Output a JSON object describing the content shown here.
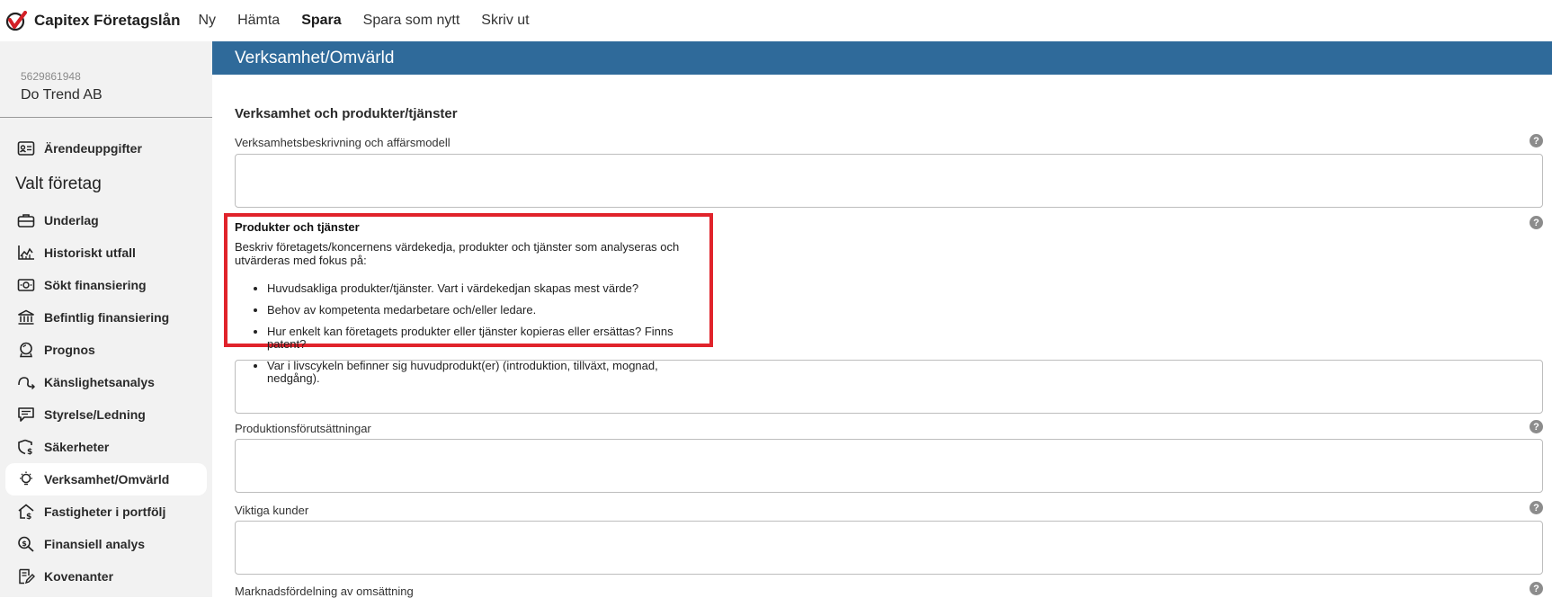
{
  "app": {
    "name": "Capitex Företagslån",
    "brand_color": "#d32027"
  },
  "topmenu": {
    "items": [
      {
        "label": "Ny"
      },
      {
        "label": "Hämta"
      },
      {
        "label": "Spara"
      },
      {
        "label": "Spara som nytt"
      },
      {
        "label": "Skriv ut"
      }
    ]
  },
  "company": {
    "orgnr": "5629861948",
    "name": "Do Trend AB"
  },
  "nav": {
    "case_item": {
      "label": "Ärendeuppgifter",
      "icon": "id-card-icon"
    },
    "section_label": "Valt företag",
    "items": [
      {
        "label": "Underlag",
        "icon": "briefcase-icon"
      },
      {
        "label": "Historiskt utfall",
        "icon": "chart-icon"
      },
      {
        "label": "Sökt finansiering",
        "icon": "money-icon"
      },
      {
        "label": "Befintlig finansiering",
        "icon": "bank-icon"
      },
      {
        "label": "Prognos",
        "icon": "crystal-ball-icon"
      },
      {
        "label": "Känslighetsanalys",
        "icon": "trend-arrow-icon"
      },
      {
        "label": "Styrelse/Ledning",
        "icon": "comment-icon"
      },
      {
        "label": "Säkerheter",
        "icon": "shield-dollar-icon"
      },
      {
        "label": "Verksamhet/Omvärld",
        "icon": "lightbulb-icon",
        "active": true
      },
      {
        "label": "Fastigheter i portfölj",
        "icon": "house-icon"
      },
      {
        "label": "Finansiell analys",
        "icon": "search-dollar-icon"
      },
      {
        "label": "Kovenanter",
        "icon": "document-edit-icon"
      }
    ]
  },
  "main": {
    "section_title": "Verksamhet/Omvärld",
    "subheading": "Verksamhet och produkter/tjänster",
    "fields": {
      "field1_label": "Verksamhetsbeskrivning och affärsmodell",
      "field3_label": "Produktionsförutsättningar",
      "field4_label": "Viktiga kunder",
      "field5_label": "Marknadsfördelning av omsättning"
    },
    "help_glyph": "?"
  },
  "tooltip": {
    "title": "Produkter och tjänster",
    "description": "Beskriv företagets/koncernens värdekedja, produkter och tjänster som analyseras och utvärderas med fokus på:",
    "bullets": [
      "Huvudsakliga produkter/tjänster. Vart i värdekedjan skapas mest värde?",
      "Behov av kompetenta medarbetare och/eller ledare.",
      "Hur enkelt kan företagets produkter eller tjänster kopieras eller ersättas? Finns patent?",
      "Var i livscykeln befinner sig huvudprodukt(er) (introduktion, tillväxt, mognad, nedgång)."
    ],
    "highlight_color": "#e0232b"
  }
}
